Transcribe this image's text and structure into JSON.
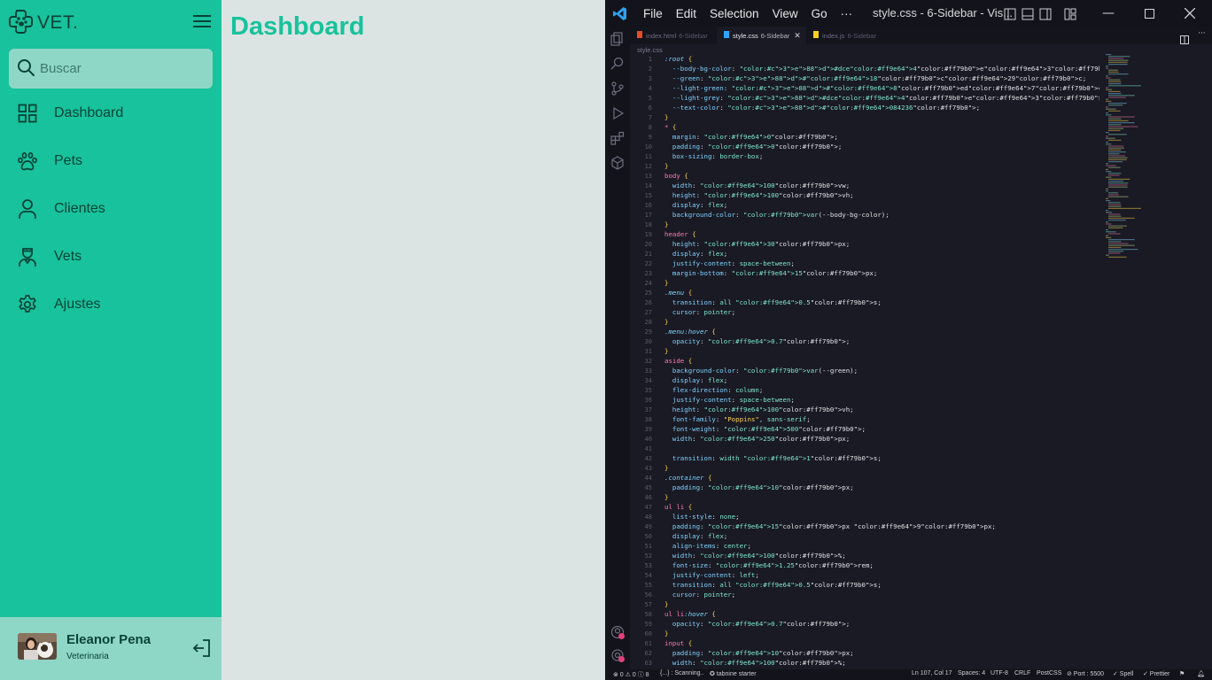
{
  "app": {
    "logo_text": "VET.",
    "search": {
      "placeholder": "Buscar",
      "value": ""
    },
    "nav": [
      {
        "label": "Dashboard",
        "icon": "grid-icon"
      },
      {
        "label": "Pets",
        "icon": "paw-icon"
      },
      {
        "label": "Clientes",
        "icon": "user-icon"
      },
      {
        "label": "Vets",
        "icon": "doctor-icon"
      },
      {
        "label": "Ajustes",
        "icon": "gear-icon"
      }
    ],
    "profile": {
      "name": "Eleanor Pena",
      "role": "Veterinaria"
    },
    "page_title": "Dashboard",
    "colors": {
      "body_bg": "#dce4e3",
      "green": "#18c29c",
      "light_green": "#8ed7c6",
      "text": "#084236"
    }
  },
  "vscode": {
    "menu": [
      "File",
      "Edit",
      "Selection",
      "View",
      "Go",
      "···"
    ],
    "window_title": "style.css - 6-Sidebar - Vis...",
    "tabs": [
      {
        "name": "index.html",
        "desc": "6-Sidebar",
        "active": false,
        "icon_color": "#e44d26"
      },
      {
        "name": "style.css",
        "desc": "6-Sidebar",
        "active": true,
        "icon_color": "#2da5ff"
      },
      {
        "name": "index.js",
        "desc": "6-Sidebar",
        "active": false,
        "icon_color": "#f5d020"
      }
    ],
    "breadcrumb": "style.css",
    "code_lines": [
      ":root {",
      "  --body-bg-color: #dce4e3;",
      "  --green: #18c29c;",
      "  --light-green: #8ed7c6;",
      "  --light-grey: #dce4e3;",
      "  --text-color: #084236;",
      "}",
      "* {",
      "  margin: 0;",
      "  padding: 0;",
      "  box-sizing: border-box;",
      "}",
      "body {",
      "  width: 100vw;",
      "  height: 100vh;",
      "  display: flex;",
      "  background-color: var(--body-bg-color);",
      "}",
      "header {",
      "  height: 30px;",
      "  display: flex;",
      "  justify-content: space-between;",
      "  margin-bottom: 15px;",
      "}",
      ".menu {",
      "  transition: all 0.5s;",
      "  cursor: pointer;",
      "}",
      ".menu:hover {",
      "  opacity: 0.7;",
      "}",
      "aside {",
      "  background-color: var(--green);",
      "  display: flex;",
      "  flex-direction: column;",
      "  justify-content: space-between;",
      "  height: 100vh;",
      "  font-family: \"Poppins\", sans-serif;",
      "  font-weight: 500;",
      "  width: 250px;",
      "",
      "  transition: width 1s;",
      "}",
      ".container {",
      "  padding: 10px;",
      "}",
      "ul li {",
      "  list-style: none;",
      "  padding: 15px 9px;",
      "  display: flex;",
      "  align-items: center;",
      "  width: 100%;",
      "  font-size: 1.25rem;",
      "  justify-content: left;",
      "  transition: all 0.5s;",
      "  cursor: pointer;",
      "}",
      "ul li:hover {",
      "  opacity: 0.7;",
      "}",
      "input {",
      "  padding: 10px;",
      "  width: 100%;"
    ],
    "status": {
      "problems": "⊗ 0 ⚠ 0 ⓘ 8",
      "scanning": "{...} : Scanning..",
      "tabnine": "✪ tabnine starter",
      "position": "Ln 107, Col 17",
      "spaces": "Spaces: 4",
      "encoding": "UTF-8",
      "eol": "CRLF",
      "language": "PostCSS",
      "port": "⊘ Port : 5500",
      "spell": "✓ Spell",
      "prettier": "✓ Prettier"
    }
  }
}
